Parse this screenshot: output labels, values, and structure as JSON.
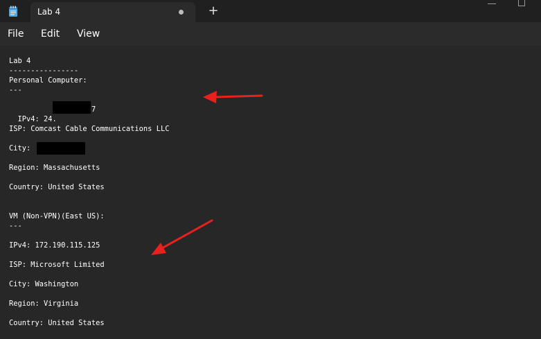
{
  "window": {
    "tab_title": "Lab 4",
    "new_tab_symbol": "+"
  },
  "menu": {
    "file": "File",
    "edit": "Edit",
    "view": "View"
  },
  "document": {
    "lines": {
      "title": "Lab 4",
      "divider": "----------------",
      "pc_heading": "Personal Computer:",
      "pc_sep": "---",
      "pc_ipv4_prefix": "IPv4: 24.",
      "pc_ipv4_suffix": "7",
      "pc_isp": "ISP: Comcast Cable Communications LLC",
      "pc_city": "City:",
      "pc_region": "Region: Massachusetts",
      "pc_country": "Country: United States",
      "vm_heading": "VM (Non-VPN)(East US):",
      "vm_sep": "---",
      "vm_ipv4": "IPv4: 172.190.115.125",
      "vm_isp": "ISP: Microsoft Limited",
      "vm_city": "City: Washington",
      "vm_region": "Region: Virginia",
      "vm_country": "Country: United States"
    }
  },
  "icons": {
    "app": "notepad-icon",
    "unsaved": "unsaved-dot-icon",
    "minimize": "minimize-icon",
    "maximize": "maximize-icon"
  },
  "colors": {
    "annotation_arrow": "#e8211e",
    "redaction": "#000000",
    "editor_bg": "#272727",
    "titlebar_bg": "#202020"
  }
}
